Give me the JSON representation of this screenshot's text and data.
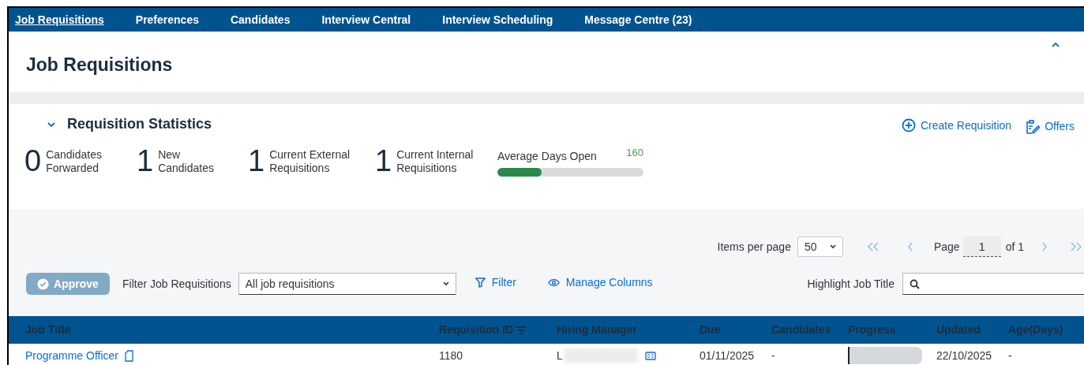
{
  "nav": [
    {
      "label": "Job Requisitions",
      "selected": true
    },
    {
      "label": "Preferences",
      "selected": false
    },
    {
      "label": "Candidates",
      "selected": false
    },
    {
      "label": "Interview Central",
      "selected": false
    },
    {
      "label": "Interview Scheduling",
      "selected": false
    },
    {
      "label": "Message Centre (23)",
      "selected": false
    }
  ],
  "page_title": "Job Requisitions",
  "statistics": {
    "title": "Requisition Statistics",
    "expanded": true,
    "counts": [
      {
        "value": "0",
        "label": "Candidates Forwarded"
      },
      {
        "value": "1",
        "label": "New Candidates"
      },
      {
        "value": "1",
        "label": "Current External Requisitions"
      },
      {
        "value": "1",
        "label": "Current Internal Requisitions"
      }
    ],
    "average_days_open": {
      "label": "Average Days Open",
      "reading": "160",
      "level": 0.3
    },
    "actions": [
      "Create Requisition",
      "Offers"
    ]
  },
  "pagination": {
    "items_per_page_label": "Items per page",
    "items_per_page": "50",
    "page_label": "Page",
    "page": "1",
    "of": "of 1"
  },
  "toolbar": {
    "approve": {
      "label": "Approve",
      "disabled": true
    },
    "filter_label": "Filter Job Requisitions",
    "filter_value": "All job requisitions",
    "filter_button": "Filter",
    "manage_columns": "Manage Columns",
    "highlight_label": "Highlight Job Title"
  },
  "table": {
    "columns": [
      "Job Title",
      "Requisition ID",
      "Hiring Manager",
      "Due",
      "Candidates",
      "Progress",
      "Updated",
      "Age(Days)"
    ],
    "rows": [
      {
        "job_title": "Programme Officer",
        "requisition_id": "1180",
        "hiring_manager": "L",
        "due": "01/11/2025",
        "candidates": "-",
        "progress": {
          "level": 0
        },
        "updated": "22/10/2025",
        "age": "-"
      }
    ]
  }
}
